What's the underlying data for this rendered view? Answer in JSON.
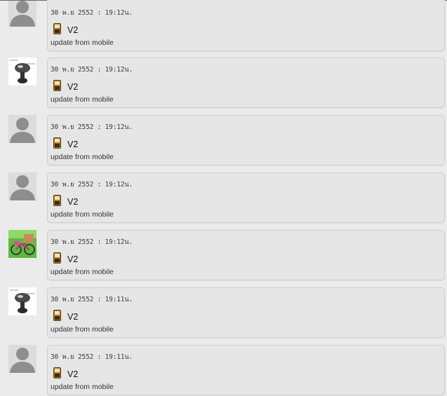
{
  "feed": {
    "items": [
      {
        "avatar": "default-avatar",
        "timestamp": "30 พ.ย 2552 : 19:12น.",
        "title": "V2",
        "source": "update from mobile"
      },
      {
        "avatar": "mushroom-avatar",
        "timestamp": "30 พ.ย 2552 : 19:12น.",
        "title": "V2",
        "source": "update from mobile"
      },
      {
        "avatar": "default-avatar",
        "timestamp": "30 พ.ย 2552 : 19:12น.",
        "title": "V2",
        "source": "update from mobile"
      },
      {
        "avatar": "default-avatar",
        "timestamp": "30 พ.ย 2552 : 19:12น.",
        "title": "V2",
        "source": "update from mobile"
      },
      {
        "avatar": "bicycle-photo-avatar",
        "timestamp": "30 พ.ย 2552 : 19:12น.",
        "title": "V2",
        "source": "update from mobile"
      },
      {
        "avatar": "mushroom-avatar",
        "timestamp": "30 พ.ย 2552 : 19:11น.",
        "title": "V2",
        "source": "update from mobile"
      },
      {
        "avatar": "default-avatar",
        "timestamp": "30 พ.ย 2552 : 19:11น.",
        "title": "V2",
        "source": "update from mobile"
      }
    ]
  },
  "colors": {
    "page_background": "#ebebeb",
    "bubble_background": "#e6e6e6",
    "bubble_border": "#cfcfcf",
    "phone_icon": "#b07a2a"
  }
}
